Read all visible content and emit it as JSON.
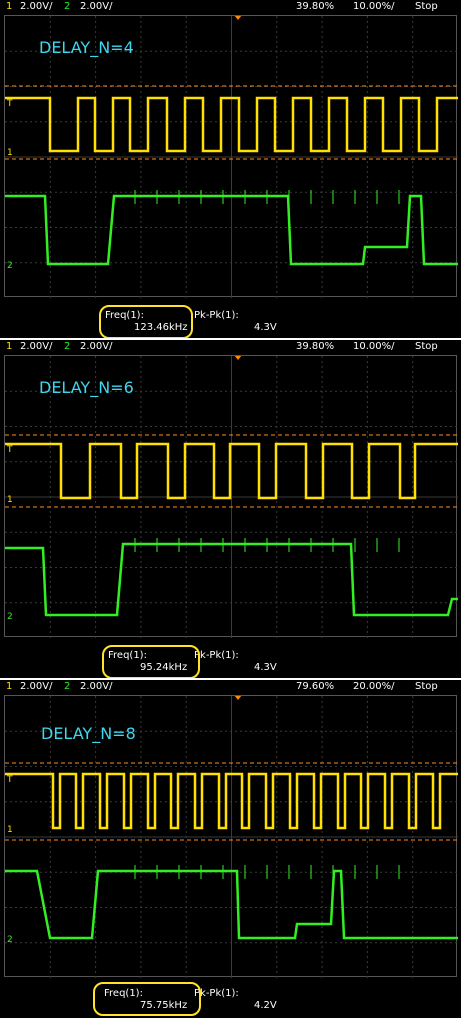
{
  "panels": [
    {
      "header": {
        "ch1_num": "1",
        "ch1_scale": "2.00V/",
        "ch2_num": "2",
        "ch2_scale": "2.00V/",
        "trigger_pos": "39.80%",
        "timebase": "10.00%/",
        "run_state": "Stop"
      },
      "delay_label": "DELAY_N=4",
      "markers": {
        "t": "T",
        "ch1": "1",
        "ch2": "2"
      },
      "measurements": {
        "freq_label": "Freq(1):",
        "freq_value": "123.46kHz",
        "pkpk_label": "Pk-Pk(1):",
        "pkpk_value": "4.3V"
      }
    },
    {
      "header": {
        "ch1_num": "1",
        "ch1_scale": "2.00V/",
        "ch2_num": "2",
        "ch2_scale": "2.00V/",
        "trigger_pos": "39.80%",
        "timebase": "10.00%/",
        "run_state": "Stop"
      },
      "delay_label": "DELAY_N=6",
      "markers": {
        "t": "T",
        "ch1": "1",
        "ch2": "2"
      },
      "measurements": {
        "freq_label": "Freq(1):",
        "freq_value": "95.24kHz",
        "pkpk_label": "Pk-Pk(1):",
        "pkpk_value": "4.3V"
      }
    },
    {
      "header": {
        "ch1_num": "1",
        "ch1_scale": "2.00V/",
        "ch2_num": "2",
        "ch2_scale": "2.00V/",
        "trigger_pos": "79.60%",
        "timebase": "20.00%/",
        "run_state": "Stop"
      },
      "delay_label": "DELAY_N=8",
      "markers": {
        "t": "T",
        "ch1": "1",
        "ch2": "2"
      },
      "measurements": {
        "freq_label": "Freq(1):",
        "freq_value": "75.75kHz",
        "pkpk_label": "Pk-Pk(1):",
        "pkpk_value": "4.2V"
      }
    }
  ],
  "colors": {
    "ch1": "#ffe000",
    "ch2": "#33ee22",
    "trigger_line": "#ff8c1a",
    "grid": "#3a3a3a",
    "delay_text": "#3fd6ee",
    "highlight": "#ffe22a"
  }
}
